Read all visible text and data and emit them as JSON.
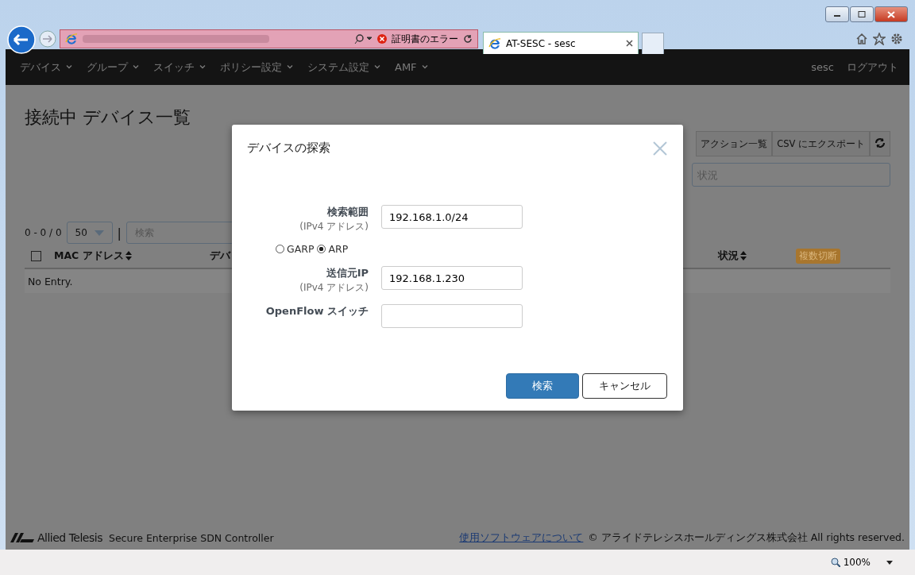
{
  "browser": {
    "cert_error": "証明書のエラー",
    "tab_title": "AT-SESC - sesc",
    "zoom": "100%"
  },
  "navbar": {
    "items": [
      {
        "label": "デバイス",
        "dropdown": true
      },
      {
        "label": "グループ",
        "dropdown": true
      },
      {
        "label": "スイッチ",
        "dropdown": true
      },
      {
        "label": "ポリシー設定",
        "dropdown": true
      },
      {
        "label": "システム設定",
        "dropdown": true
      },
      {
        "label": "AMF",
        "dropdown": true
      }
    ],
    "user": "sesc",
    "logout": "ログアウト"
  },
  "page": {
    "title": "接続中 デバイス一覧",
    "toolbar": [
      "アクション一覧",
      "CSV にエクスポート"
    ],
    "filter_placeholder": "状況",
    "range": "0 - 0 / 0",
    "page_size": "50",
    "separator": "|",
    "search_placeholder": "検索",
    "select_all_checked": false,
    "columns": [
      {
        "label": "MAC アドレス",
        "sortable": true
      },
      {
        "label": "デバ"
      },
      {
        "label": "状況",
        "sortable": true
      }
    ],
    "badge": "複数切断",
    "empty": "No Entry."
  },
  "dialog": {
    "title": "デバイスの探索",
    "fields": [
      {
        "label": "検索範囲",
        "sublabel": "(IPv4 アドレス)",
        "value": "192.168.1.0/24"
      }
    ],
    "modes": [
      {
        "label": "GARP",
        "selected": false
      },
      {
        "label": "ARP",
        "selected": true
      }
    ],
    "fields2": [
      {
        "label": "送信元IP",
        "sublabel": "(IPv4 アドレス)",
        "value": "192.168.1.230"
      },
      {
        "label": "OpenFlow スイッチ"
      }
    ],
    "buttons": [
      {
        "label": "検索",
        "kind": "primary"
      },
      {
        "label": "キャンセル",
        "kind": "default"
      }
    ]
  },
  "footer": {
    "brand": "Allied Telesis",
    "product": "Secure Enterprise SDN Controller",
    "link": "使用ソフトウェアについて",
    "copyright": "© アライドテレシスホールディングス株式会社 All rights reserved."
  }
}
